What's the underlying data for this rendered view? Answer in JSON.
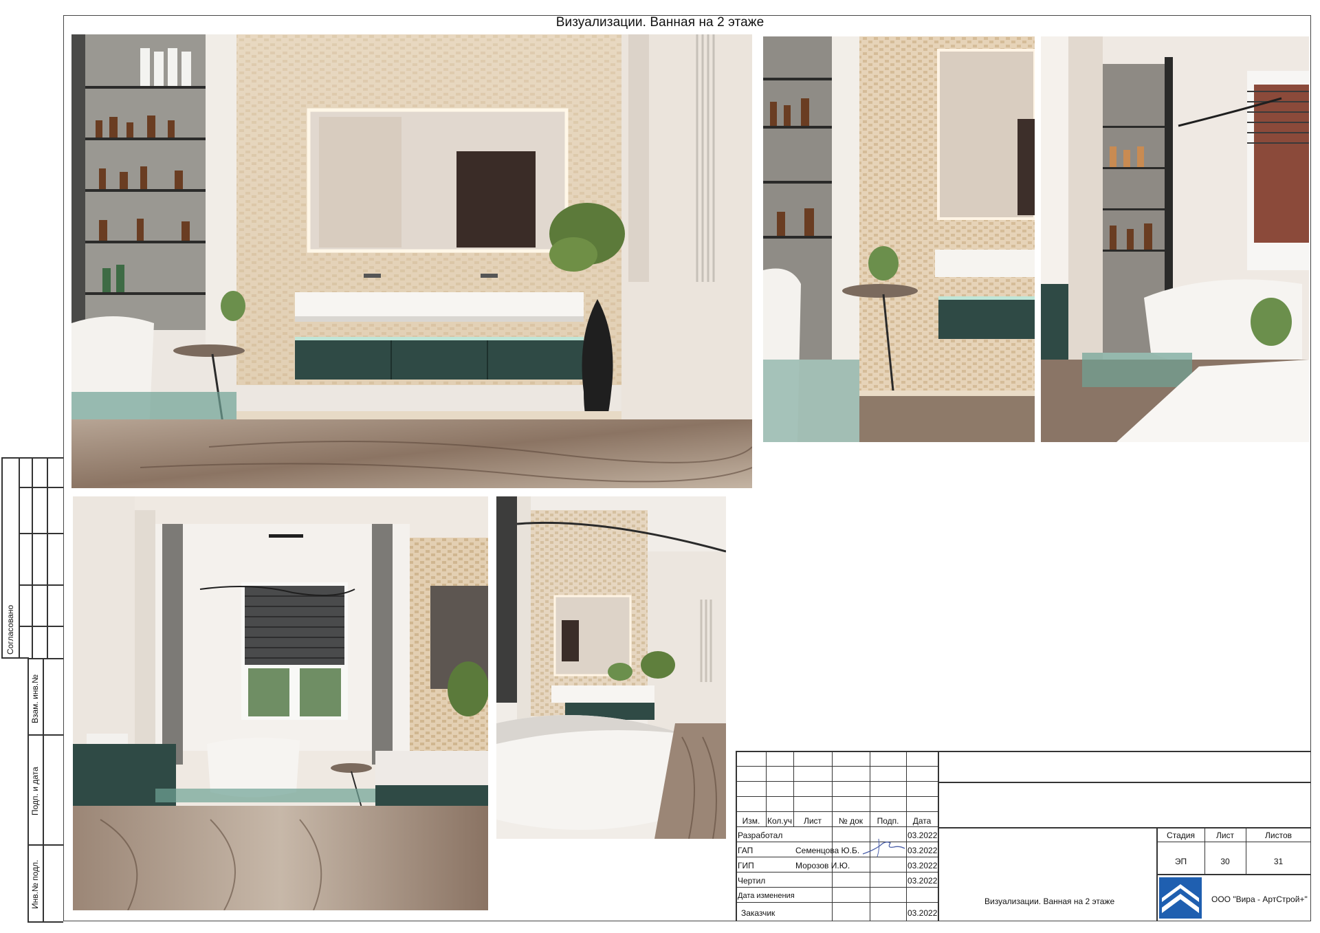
{
  "sheet": {
    "title": "Визуализации. Ванная на 2 этаже"
  },
  "side_stamp": {
    "agreed": "Согласовано",
    "vzam_inv": "Взам. инв.№",
    "sign_date": "Подп. и дата",
    "inv_podl": "Инв.№ подл."
  },
  "title_block": {
    "headers": [
      "Изм.",
      "Кол.уч",
      "Лист",
      "№ док",
      "Подп.",
      "Дата"
    ],
    "rows": [
      {
        "role": "Разработал",
        "name": "",
        "date": "03.2022"
      },
      {
        "role": "ГАП",
        "name": "Семенцова Ю.Б.",
        "date": "03.2022"
      },
      {
        "role": "ГИП",
        "name": "Морозов И.Ю.",
        "date": "03.2022"
      },
      {
        "role": "Чертил",
        "name": "",
        "date": "03.2022"
      },
      {
        "role": "Дата изменения",
        "name": "",
        "date": ""
      },
      {
        "role": "Заказчик",
        "name": "",
        "date": "03.2022"
      }
    ],
    "drawing_name": "Визуализации. Ванная на 2 этаже",
    "stage_label": "Стадия",
    "sheet_label": "Лист",
    "sheets_label": "Листов",
    "stage": "ЭП",
    "sheet_no": "30",
    "sheets_total": "31",
    "company": "ООО \"Вира - АртСтрой+\"",
    "logo": "company-logo-icon"
  },
  "renders": [
    {
      "id": "render-main-view"
    },
    {
      "id": "render-vanity-side-view"
    },
    {
      "id": "render-bathtub-window-view"
    },
    {
      "id": "render-window-axis-view"
    },
    {
      "id": "render-bathtub-corner-view"
    }
  ]
}
